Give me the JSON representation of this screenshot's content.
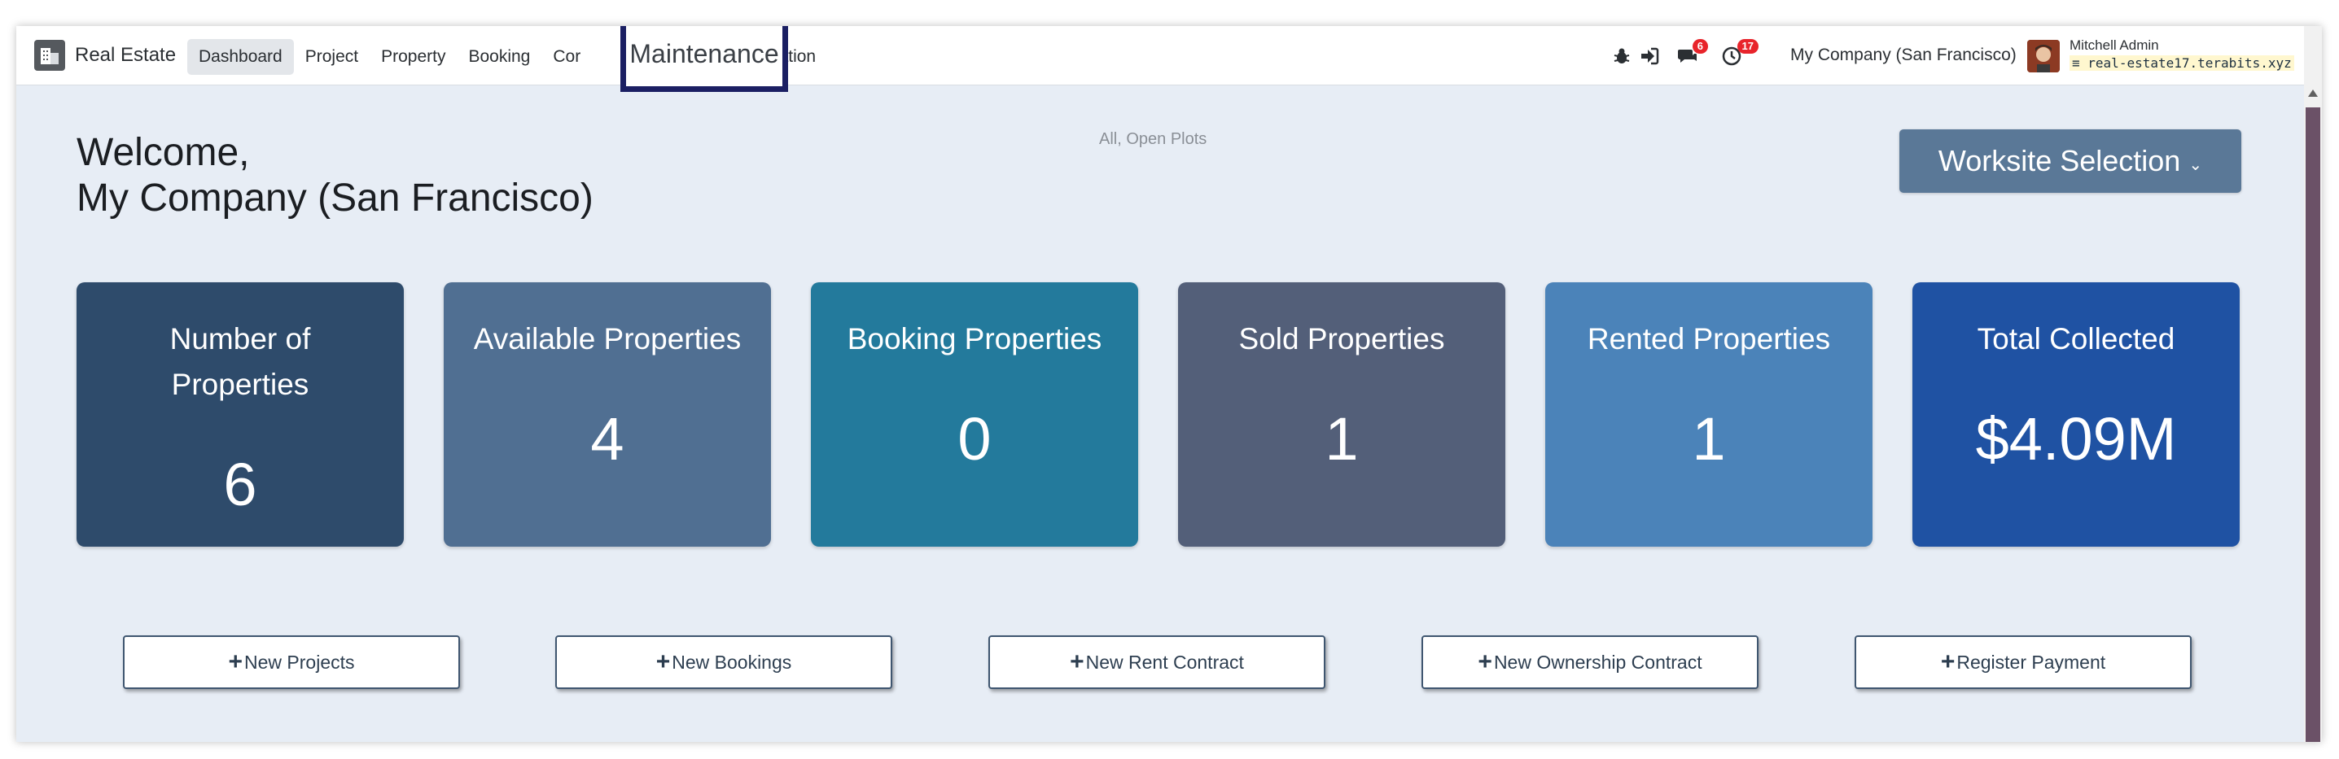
{
  "navbar": {
    "app_name": "Real Estate",
    "menu": [
      {
        "label": "Dashboard",
        "active": true
      },
      {
        "label": "Project"
      },
      {
        "label": "Property"
      },
      {
        "label": "Booking"
      },
      {
        "label": "Cor"
      },
      {
        "label": "Configuration"
      }
    ],
    "highlighted_menu": "Maintenance",
    "messages_badge": "6",
    "activities_badge": "17",
    "company": "My Company (San Francisco)",
    "user_name": "Mitchell Admin",
    "database": "real-estate17.terabits.xyz"
  },
  "header": {
    "welcome_line1": "Welcome,",
    "welcome_line2": "My Company (San Francisco)",
    "filter_label": "All, Open Plots",
    "worksite_button": "Worksite Selection",
    "worksite_caret": "⌄"
  },
  "cards": [
    {
      "title": "Number of Properties",
      "value": "6",
      "color": "#2e4b6b"
    },
    {
      "title": "Available Properties",
      "value": "4",
      "color": "#506f92"
    },
    {
      "title": "Booking Properties",
      "value": "0",
      "color": "#237a9c"
    },
    {
      "title": "Sold Properties",
      "value": "1",
      "color": "#535f79"
    },
    {
      "title": "Rented Properties",
      "value": "1",
      "color": "#4b83b9"
    },
    {
      "title": "Total Collected",
      "value": "$4.09M",
      "color": "#1f52a3"
    }
  ],
  "actions": [
    {
      "label": "New Projects"
    },
    {
      "label": "New Bookings"
    },
    {
      "label": "New Rent Contract"
    },
    {
      "label": "New Ownership Contract"
    },
    {
      "label": "Register Payment"
    }
  ],
  "icons": {
    "app_logo": "building-icon",
    "debug": "bug-icon",
    "login": "sign-in-icon",
    "messages": "chat-icon",
    "activities": "clock-icon",
    "db": "database-icon",
    "plus": "+"
  }
}
